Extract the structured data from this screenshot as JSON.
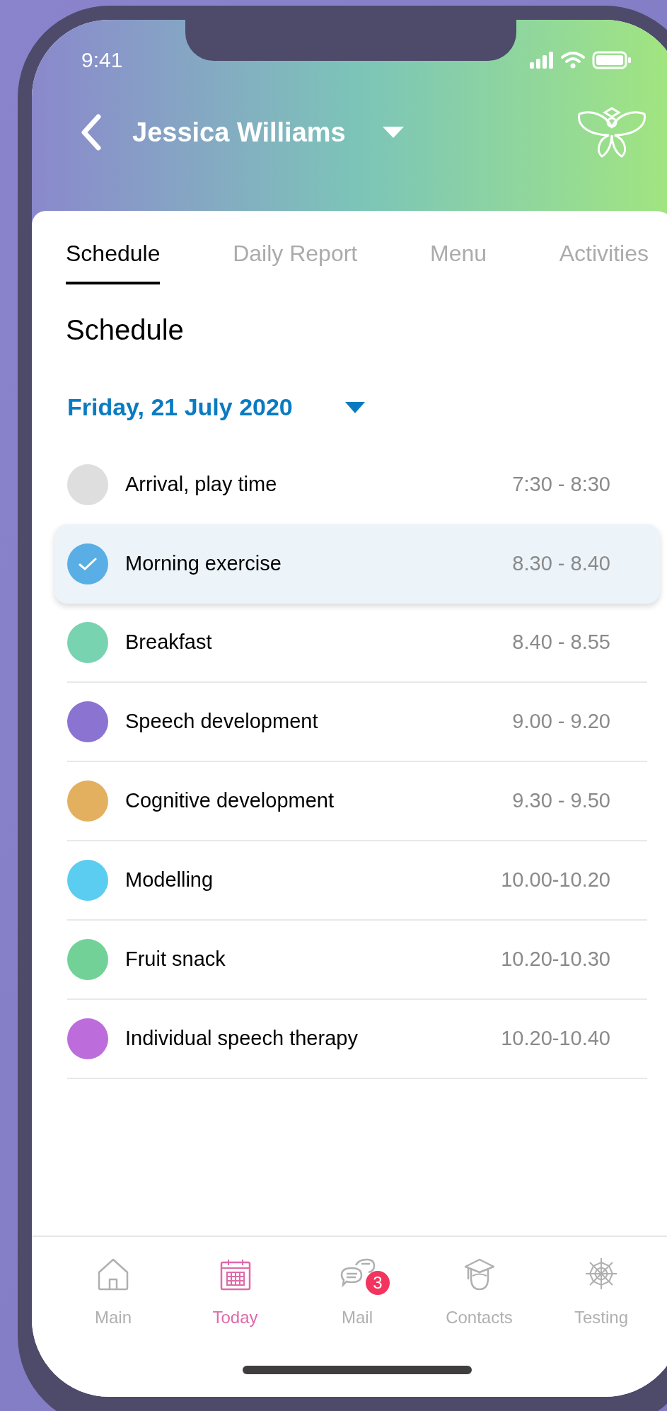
{
  "status_bar": {
    "time": "9:41"
  },
  "header": {
    "title": "Jessica Williams"
  },
  "tabs": [
    {
      "label": "Schedule",
      "selected": true
    },
    {
      "label": "Daily Report",
      "selected": false
    },
    {
      "label": "Menu",
      "selected": false
    },
    {
      "label": "Activities",
      "selected": false
    }
  ],
  "heading": "Schedule",
  "date": "Friday, 21 July 2020",
  "schedule": [
    {
      "title": "Arrival, play time",
      "time": "7:30 - 8:30",
      "color": "#dedede",
      "done": false,
      "selected": false
    },
    {
      "title": "Morning exercise",
      "time": "8.30 - 8.40",
      "color": "#5aaee6",
      "done": true,
      "selected": true
    },
    {
      "title": "Breakfast",
      "time": "8.40 - 8.55",
      "color": "#78d3b0",
      "done": false,
      "selected": false
    },
    {
      "title": "Speech development",
      "time": "9.00 - 9.20",
      "color": "#8a73d1",
      "done": false,
      "selected": false
    },
    {
      "title": "Cognitive development",
      "time": "9.30 - 9.50",
      "color": "#e3b060",
      "done": false,
      "selected": false
    },
    {
      "title": "Modelling",
      "time": "10.00-10.20",
      "color": "#5bcdf0",
      "done": false,
      "selected": false
    },
    {
      "title": "Fruit snack",
      "time": "10.20-10.30",
      "color": "#72d197",
      "done": false,
      "selected": false
    },
    {
      "title": "Individual speech therapy",
      "time": "10.20-10.40",
      "color": "#bd6ddb",
      "done": false,
      "selected": false
    }
  ],
  "bottom_nav": [
    {
      "label": "Main",
      "kind": "home",
      "selected": false
    },
    {
      "label": "Today",
      "kind": "calendar",
      "selected": true
    },
    {
      "label": "Mail",
      "kind": "chat",
      "selected": false,
      "badge": "3"
    },
    {
      "label": "Contacts",
      "kind": "graduate",
      "selected": false
    },
    {
      "label": "Testing",
      "kind": "web",
      "selected": false
    }
  ]
}
